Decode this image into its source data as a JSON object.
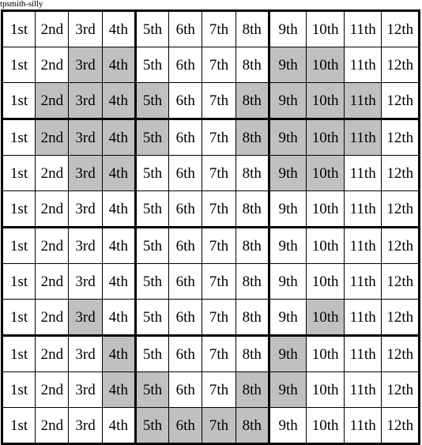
{
  "title": "tpsmith-silly",
  "grid": {
    "rows": 12,
    "cols": 12,
    "block_cols": [
      4,
      8
    ],
    "block_rows": [
      3,
      6,
      9
    ],
    "shade_color": "#c0c0c0",
    "empty_color": "#ffffff",
    "border_color": "#000000",
    "labels": [
      "1st",
      "2nd",
      "3rd",
      "4th",
      "5th",
      "6th",
      "7th",
      "8th",
      "9th",
      "10th",
      "11th",
      "12th"
    ],
    "cells": [
      [
        {
          "label": "1st",
          "shaded": false
        },
        {
          "label": "2nd",
          "shaded": false
        },
        {
          "label": "3rd",
          "shaded": false
        },
        {
          "label": "4th",
          "shaded": false
        },
        {
          "label": "5th",
          "shaded": false
        },
        {
          "label": "6th",
          "shaded": false
        },
        {
          "label": "7th",
          "shaded": false
        },
        {
          "label": "8th",
          "shaded": false
        },
        {
          "label": "9th",
          "shaded": false
        },
        {
          "label": "10th",
          "shaded": false
        },
        {
          "label": "11th",
          "shaded": false
        },
        {
          "label": "12th",
          "shaded": false
        }
      ],
      [
        {
          "label": "1st",
          "shaded": false
        },
        {
          "label": "2nd",
          "shaded": false
        },
        {
          "label": "3rd",
          "shaded": true
        },
        {
          "label": "4th",
          "shaded": true
        },
        {
          "label": "5th",
          "shaded": false
        },
        {
          "label": "6th",
          "shaded": false
        },
        {
          "label": "7th",
          "shaded": false
        },
        {
          "label": "8th",
          "shaded": false
        },
        {
          "label": "9th",
          "shaded": true
        },
        {
          "label": "10th",
          "shaded": true
        },
        {
          "label": "11th",
          "shaded": false
        },
        {
          "label": "12th",
          "shaded": false
        }
      ],
      [
        {
          "label": "1st",
          "shaded": false
        },
        {
          "label": "2nd",
          "shaded": true
        },
        {
          "label": "3rd",
          "shaded": true
        },
        {
          "label": "4th",
          "shaded": true
        },
        {
          "label": "5th",
          "shaded": true
        },
        {
          "label": "6th",
          "shaded": false
        },
        {
          "label": "7th",
          "shaded": false
        },
        {
          "label": "8th",
          "shaded": true
        },
        {
          "label": "9th",
          "shaded": true
        },
        {
          "label": "10th",
          "shaded": true
        },
        {
          "label": "11th",
          "shaded": true
        },
        {
          "label": "12th",
          "shaded": false
        }
      ],
      [
        {
          "label": "1st",
          "shaded": false
        },
        {
          "label": "2nd",
          "shaded": true
        },
        {
          "label": "3rd",
          "shaded": true
        },
        {
          "label": "4th",
          "shaded": true
        },
        {
          "label": "5th",
          "shaded": true
        },
        {
          "label": "6th",
          "shaded": false
        },
        {
          "label": "7th",
          "shaded": false
        },
        {
          "label": "8th",
          "shaded": true
        },
        {
          "label": "9th",
          "shaded": true
        },
        {
          "label": "10th",
          "shaded": true
        },
        {
          "label": "11th",
          "shaded": true
        },
        {
          "label": "12th",
          "shaded": false
        }
      ],
      [
        {
          "label": "1st",
          "shaded": false
        },
        {
          "label": "2nd",
          "shaded": false
        },
        {
          "label": "3rd",
          "shaded": true
        },
        {
          "label": "4th",
          "shaded": true
        },
        {
          "label": "5th",
          "shaded": false
        },
        {
          "label": "6th",
          "shaded": false
        },
        {
          "label": "7th",
          "shaded": false
        },
        {
          "label": "8th",
          "shaded": false
        },
        {
          "label": "9th",
          "shaded": true
        },
        {
          "label": "10th",
          "shaded": true
        },
        {
          "label": "11th",
          "shaded": false
        },
        {
          "label": "12th",
          "shaded": false
        }
      ],
      [
        {
          "label": "1st",
          "shaded": false
        },
        {
          "label": "2nd",
          "shaded": false
        },
        {
          "label": "3rd",
          "shaded": false
        },
        {
          "label": "4th",
          "shaded": false
        },
        {
          "label": "5th",
          "shaded": false
        },
        {
          "label": "6th",
          "shaded": false
        },
        {
          "label": "7th",
          "shaded": false
        },
        {
          "label": "8th",
          "shaded": false
        },
        {
          "label": "9th",
          "shaded": false
        },
        {
          "label": "10th",
          "shaded": false
        },
        {
          "label": "11th",
          "shaded": false
        },
        {
          "label": "12th",
          "shaded": false
        }
      ],
      [
        {
          "label": "1st",
          "shaded": false
        },
        {
          "label": "2nd",
          "shaded": false
        },
        {
          "label": "3rd",
          "shaded": false
        },
        {
          "label": "4th",
          "shaded": false
        },
        {
          "label": "5th",
          "shaded": false
        },
        {
          "label": "6th",
          "shaded": false
        },
        {
          "label": "7th",
          "shaded": false
        },
        {
          "label": "8th",
          "shaded": false
        },
        {
          "label": "9th",
          "shaded": false
        },
        {
          "label": "10th",
          "shaded": false
        },
        {
          "label": "11th",
          "shaded": false
        },
        {
          "label": "12th",
          "shaded": false
        }
      ],
      [
        {
          "label": "1st",
          "shaded": false
        },
        {
          "label": "2nd",
          "shaded": false
        },
        {
          "label": "3rd",
          "shaded": false
        },
        {
          "label": "4th",
          "shaded": false
        },
        {
          "label": "5th",
          "shaded": false
        },
        {
          "label": "6th",
          "shaded": false
        },
        {
          "label": "7th",
          "shaded": false
        },
        {
          "label": "8th",
          "shaded": false
        },
        {
          "label": "9th",
          "shaded": false
        },
        {
          "label": "10th",
          "shaded": false
        },
        {
          "label": "11th",
          "shaded": false
        },
        {
          "label": "12th",
          "shaded": false
        }
      ],
      [
        {
          "label": "1st",
          "shaded": false
        },
        {
          "label": "2nd",
          "shaded": false
        },
        {
          "label": "3rd",
          "shaded": true
        },
        {
          "label": "4th",
          "shaded": false
        },
        {
          "label": "5th",
          "shaded": false
        },
        {
          "label": "6th",
          "shaded": false
        },
        {
          "label": "7th",
          "shaded": false
        },
        {
          "label": "8th",
          "shaded": false
        },
        {
          "label": "9th",
          "shaded": false
        },
        {
          "label": "10th",
          "shaded": true
        },
        {
          "label": "11th",
          "shaded": false
        },
        {
          "label": "12th",
          "shaded": false
        }
      ],
      [
        {
          "label": "1st",
          "shaded": false
        },
        {
          "label": "2nd",
          "shaded": false
        },
        {
          "label": "3rd",
          "shaded": false
        },
        {
          "label": "4th",
          "shaded": true
        },
        {
          "label": "5th",
          "shaded": false
        },
        {
          "label": "6th",
          "shaded": false
        },
        {
          "label": "7th",
          "shaded": false
        },
        {
          "label": "8th",
          "shaded": false
        },
        {
          "label": "9th",
          "shaded": true
        },
        {
          "label": "10th",
          "shaded": false
        },
        {
          "label": "11th",
          "shaded": false
        },
        {
          "label": "12th",
          "shaded": false
        }
      ],
      [
        {
          "label": "1st",
          "shaded": false
        },
        {
          "label": "2nd",
          "shaded": false
        },
        {
          "label": "3rd",
          "shaded": false
        },
        {
          "label": "4th",
          "shaded": true
        },
        {
          "label": "5th",
          "shaded": true
        },
        {
          "label": "6th",
          "shaded": false
        },
        {
          "label": "7th",
          "shaded": false
        },
        {
          "label": "8th",
          "shaded": true
        },
        {
          "label": "9th",
          "shaded": true
        },
        {
          "label": "10th",
          "shaded": false
        },
        {
          "label": "11th",
          "shaded": false
        },
        {
          "label": "12th",
          "shaded": false
        }
      ],
      [
        {
          "label": "1st",
          "shaded": false
        },
        {
          "label": "2nd",
          "shaded": false
        },
        {
          "label": "3rd",
          "shaded": false
        },
        {
          "label": "4th",
          "shaded": false
        },
        {
          "label": "5th",
          "shaded": true
        },
        {
          "label": "6th",
          "shaded": true
        },
        {
          "label": "7th",
          "shaded": true
        },
        {
          "label": "8th",
          "shaded": true
        },
        {
          "label": "9th",
          "shaded": false
        },
        {
          "label": "10th",
          "shaded": false
        },
        {
          "label": "11th",
          "shaded": false
        },
        {
          "label": "12th",
          "shaded": false
        }
      ]
    ]
  }
}
